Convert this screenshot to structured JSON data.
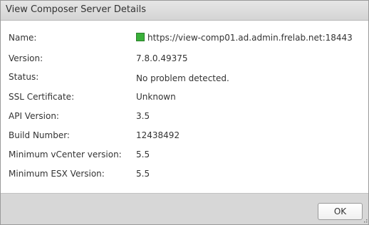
{
  "window": {
    "title": "View Composer Server Details"
  },
  "details": [
    {
      "label": "Name:",
      "value": "https://view-comp01.ad.admin.frelab.net:18443"
    },
    {
      "label": "Version:",
      "value": "7.8.0.49375"
    },
    {
      "label": "Status:",
      "value": "No problem detected."
    },
    {
      "label": "SSL Certificate:",
      "value": "Unknown"
    },
    {
      "label": "API Version:",
      "value": "3.5"
    },
    {
      "label": "Build Number:",
      "value": "12438492"
    },
    {
      "label": "Minimum vCenter version:",
      "value": "5.5"
    },
    {
      "label": "Minimum ESX Version:",
      "value": "5.5"
    }
  ],
  "name_status_icon": "green-status-icon",
  "colors": {
    "status_green": "#3ab03a",
    "footer_bg": "#d7d7d7",
    "titlebar_bg": "#dcdcdc"
  },
  "footer": {
    "ok_label": "OK"
  }
}
